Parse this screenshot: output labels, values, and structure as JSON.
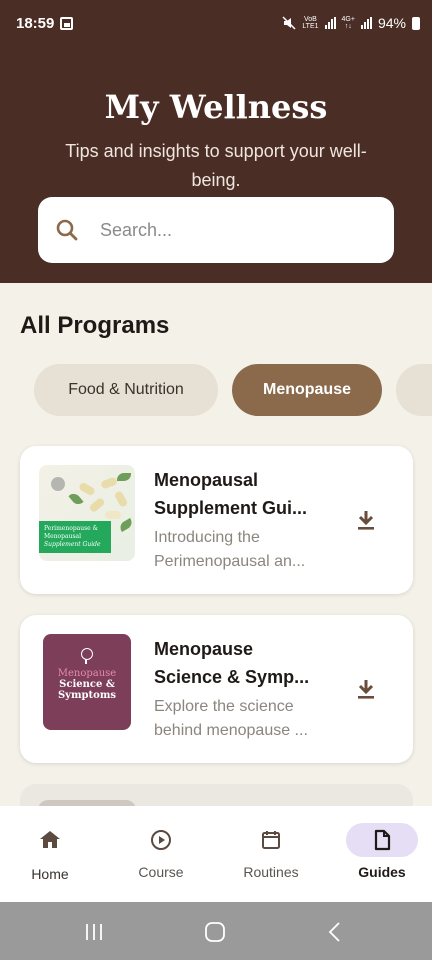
{
  "status_bar": {
    "time": "18:59",
    "network_top": "VoB",
    "network_bottom": "LTE1",
    "network2_top": "4G+",
    "battery": "94%"
  },
  "header": {
    "title": "My Wellness",
    "subtitle": "Tips and insights to support your well-being."
  },
  "search": {
    "placeholder": "Search..."
  },
  "section_title": "All Programs",
  "chips": [
    {
      "label": "Food & Nutrition",
      "selected": false
    },
    {
      "label": "Menopause",
      "selected": true
    }
  ],
  "programs": [
    {
      "title_line1": "Menopausal",
      "title_line2": "Supplement Gui...",
      "desc_line1": "Introducing the",
      "desc_line2": "Perimenopausal an...",
      "thumb_text_line1": "Perimenopause &",
      "thumb_text_line2": "Menopausal",
      "thumb_text_line3": "Supplement Guide",
      "thumb_color": "#23a85c"
    },
    {
      "title_line1": "Menopause",
      "title_line2": "Science & Symp...",
      "desc_line1": "Explore the science",
      "desc_line2": "behind menopause ...",
      "thumb_text_line1": "Menopause",
      "thumb_text_line2": "Science &",
      "thumb_text_line3": "Symptoms",
      "thumb_color": "#7d3e5a"
    }
  ],
  "bottom_nav": [
    {
      "label": "Home",
      "icon": "home-icon"
    },
    {
      "label": "Course",
      "icon": "play-circle-icon"
    },
    {
      "label": "Routines",
      "icon": "calendar-icon"
    },
    {
      "label": "Guides",
      "icon": "document-icon",
      "active": true
    }
  ],
  "colors": {
    "header_bg": "#4a2d24",
    "page_bg": "#f3f1e8",
    "chip_selected": "#8b6a4c",
    "chip_default": "#e7e0d4",
    "nav_active_pill": "#e5def5"
  }
}
